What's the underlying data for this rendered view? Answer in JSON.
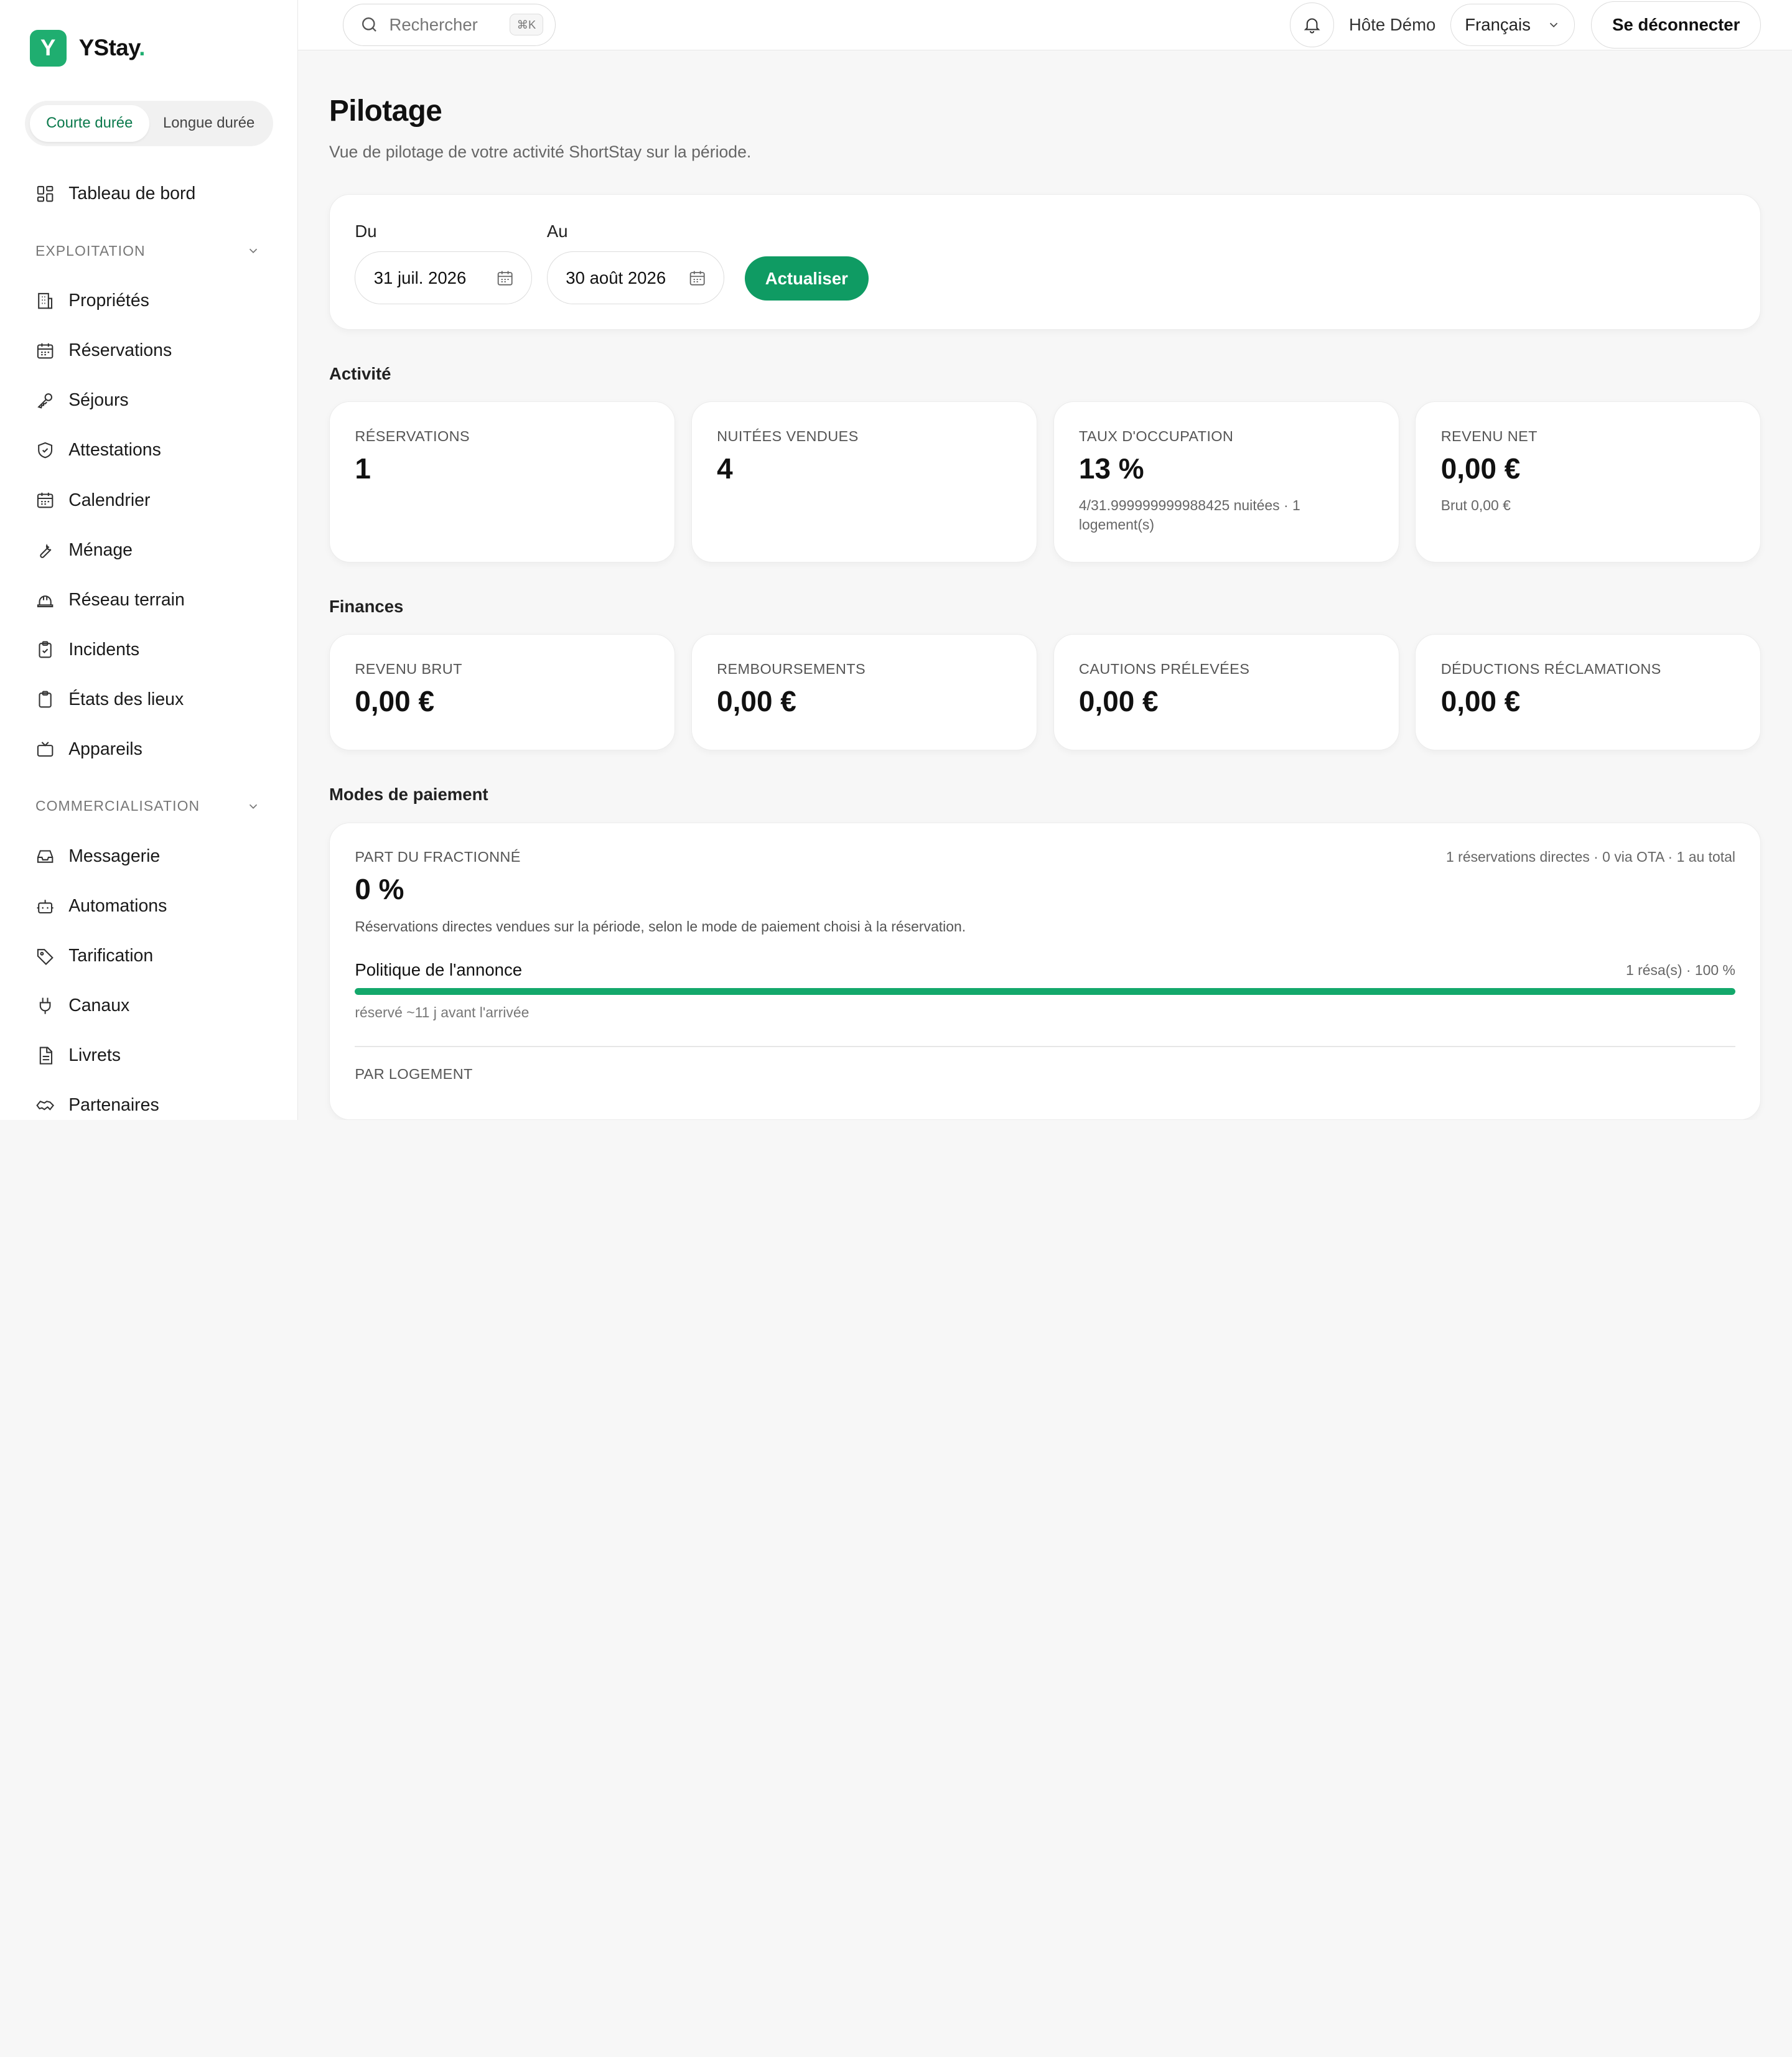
{
  "brand": {
    "initial": "Y",
    "name": "YStay",
    "dot": ".",
    "accent": "#1fae70"
  },
  "mode_toggle": {
    "short_label": "Courte durée",
    "long_label": "Longue durée",
    "active": "short"
  },
  "sidebar": {
    "dashboard": {
      "label": "Tableau de bord",
      "icon": "dashboard-icon"
    },
    "sections": [
      {
        "title": "EXPLOITATION",
        "items": [
          {
            "label": "Propriétés",
            "icon": "building-icon"
          },
          {
            "label": "Réservations",
            "icon": "calendar-icon"
          },
          {
            "label": "Séjours",
            "icon": "key-icon"
          },
          {
            "label": "Attestations",
            "icon": "shield-icon"
          },
          {
            "label": "Calendrier",
            "icon": "calendar-icon"
          },
          {
            "label": "Ménage",
            "icon": "wrench-icon"
          },
          {
            "label": "Réseau terrain",
            "icon": "helmet-icon"
          },
          {
            "label": "Incidents",
            "icon": "clipboard-check-icon"
          },
          {
            "label": "États des lieux",
            "icon": "clipboard-icon"
          },
          {
            "label": "Appareils",
            "icon": "tv-icon"
          }
        ]
      },
      {
        "title": "COMMERCIALISATION",
        "items": [
          {
            "label": "Messagerie",
            "icon": "inbox-icon"
          },
          {
            "label": "Automations",
            "icon": "bot-icon"
          },
          {
            "label": "Tarification",
            "icon": "tag-icon"
          },
          {
            "label": "Canaux",
            "icon": "plug-icon"
          },
          {
            "label": "Livrets",
            "icon": "file-icon"
          },
          {
            "label": "Partenaires",
            "icon": "handshake-icon"
          }
        ]
      }
    ]
  },
  "topbar": {
    "search_placeholder": "Rechercher",
    "search_shortcut": "⌘K",
    "host_name": "Hôte Démo",
    "language": "Français",
    "logout_label": "Se déconnecter"
  },
  "page": {
    "title": "Pilotage",
    "subtitle": "Vue de pilotage de votre activité ShortStay sur la période."
  },
  "filters": {
    "from_label": "Du",
    "from_value": "31 juil. 2026",
    "to_label": "Au",
    "to_value": "30 août 2026",
    "refresh_label": "Actualiser"
  },
  "activity": {
    "title": "Activité",
    "kpis": [
      {
        "label": "RÉSERVATIONS",
        "value": "1",
        "sub": ""
      },
      {
        "label": "NUITÉES VENDUES",
        "value": "4",
        "sub": ""
      },
      {
        "label": "TAUX D'OCCUPATION",
        "value": "13 %",
        "sub": "4/31.999999999988425 nuitées · 1 logement(s)"
      },
      {
        "label": "REVENU NET",
        "value": "0,00 €",
        "sub": "Brut 0,00 €"
      }
    ]
  },
  "finances": {
    "title": "Finances",
    "kpis": [
      {
        "label": "REVENU BRUT",
        "value": "0,00 €"
      },
      {
        "label": "REMBOURSEMENTS",
        "value": "0,00 €"
      },
      {
        "label": "CAUTIONS PRÉLEVÉES",
        "value": "0,00 €"
      },
      {
        "label": "DÉDUCTIONS RÉCLAMATIONS",
        "value": "0,00 €"
      }
    ]
  },
  "payment_modes": {
    "title": "Modes de paiement",
    "split_label": "PART DU FRACTIONNÉ",
    "split_value": "0 %",
    "meta": "1 réservations directes · 0 via OTA · 1 au total",
    "description": "Réservations directes vendues sur la période, selon le mode de paiement choisi à la réservation.",
    "policy": {
      "name": "Politique de l'annonce",
      "stats": "1 résa(s) · 100 %",
      "progress_percent": 100,
      "sub": "réservé ~11 j avant l'arrivée",
      "bar_color": "#13a86b"
    },
    "by_lodging_label": "PAR LOGEMENT"
  }
}
